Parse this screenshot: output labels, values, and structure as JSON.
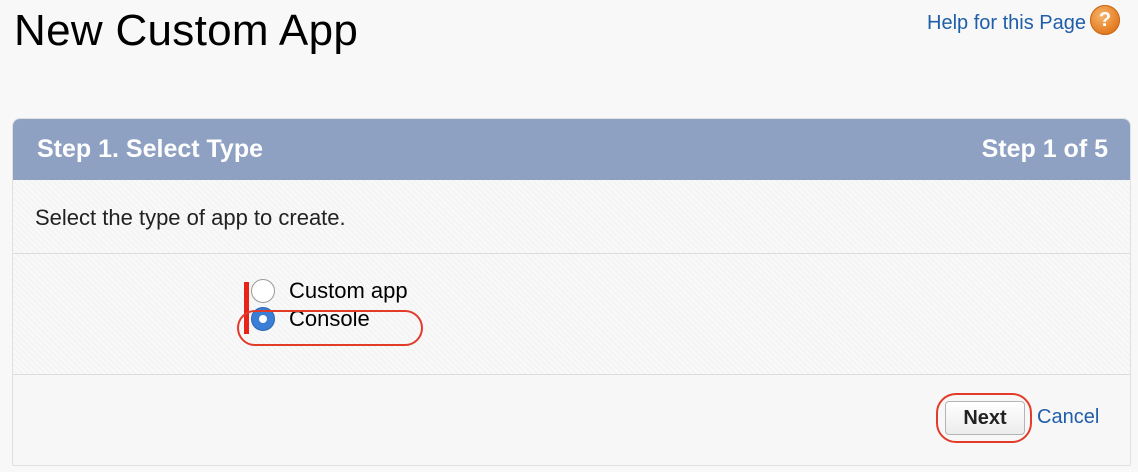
{
  "header": {
    "title": "New Custom App",
    "help_link": "Help for this Page",
    "help_icon": "?"
  },
  "panel": {
    "step_title": "Step 1. Select Type",
    "step_counter": "Step 1 of 5",
    "description": "Select the type of app to create.",
    "options": [
      {
        "label": "Custom app",
        "selected": false
      },
      {
        "label": "Console",
        "selected": true
      }
    ]
  },
  "footer": {
    "next_label": "Next",
    "cancel_label": "Cancel"
  },
  "colors": {
    "header_bar": "#8fa1c2",
    "link": "#1f5ea8",
    "annotation": "#e23b2a",
    "radio_selected": "#3a7fd5"
  }
}
